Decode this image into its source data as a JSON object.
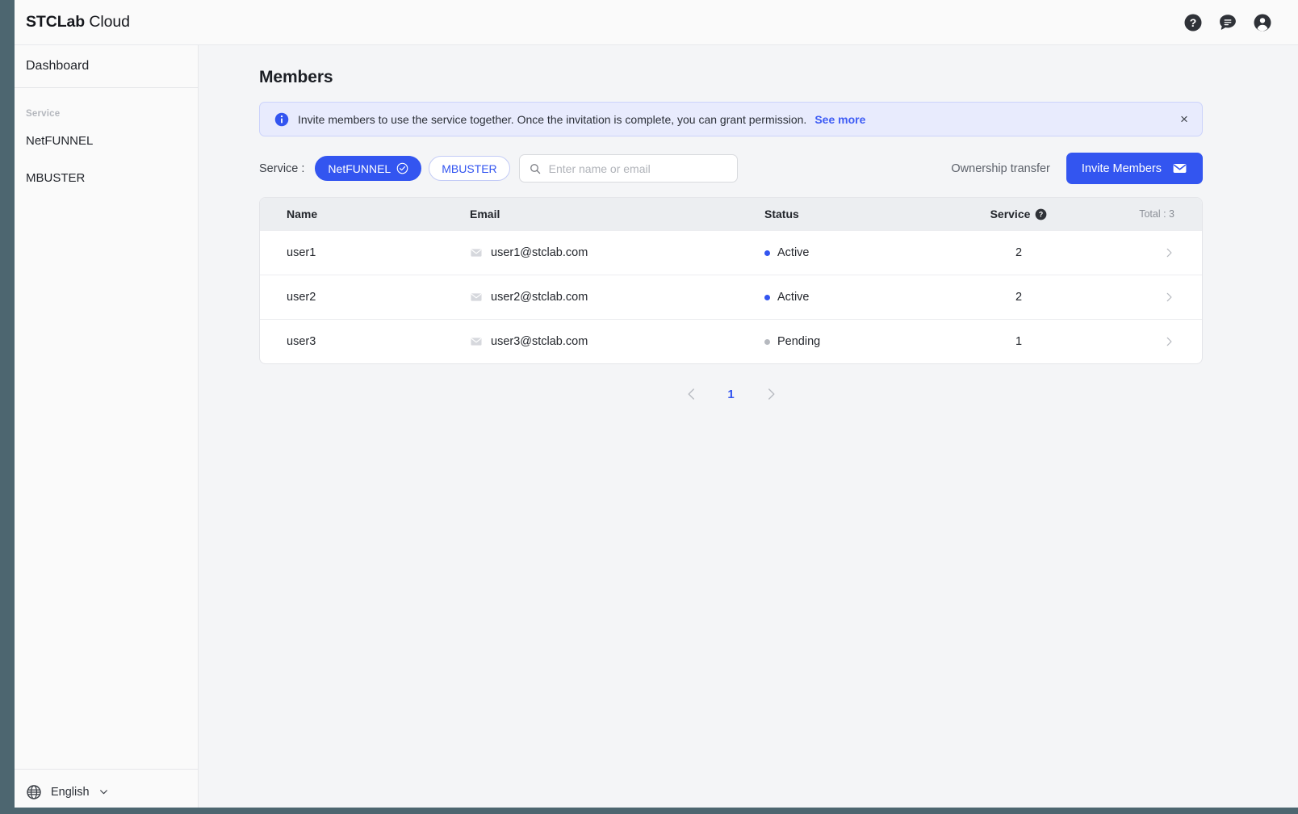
{
  "brand": {
    "bold": "STCLab",
    "regular": "Cloud"
  },
  "topbar": {
    "icons": [
      {
        "name": "help-icon",
        "label": "Help"
      },
      {
        "name": "chat-icon",
        "label": "Chat"
      },
      {
        "name": "account-icon",
        "label": "Account"
      }
    ]
  },
  "sidebar": {
    "dashboard_label": "Dashboard",
    "section_label": "Service",
    "items": [
      {
        "label": "NetFUNNEL"
      },
      {
        "label": "MBUSTER"
      }
    ],
    "language": {
      "label": "English"
    }
  },
  "main": {
    "page_title": "Members",
    "banner": {
      "text": "Invite members to use the service together. Once the invitation is complete, you can grant permission.",
      "link": "See more",
      "close": "×"
    },
    "filter": {
      "service_label": "Service :",
      "chips": [
        {
          "label": "NetFUNNEL",
          "active": true
        },
        {
          "label": "MBUSTER",
          "active": false
        }
      ],
      "search_placeholder": "Enter name or email",
      "search_value": "",
      "ownership_label": "Ownership transfer",
      "invite_label": "Invite Members"
    },
    "table": {
      "columns": [
        "Name",
        "Email",
        "Status",
        "Service"
      ],
      "total_label": "Total : 3",
      "rows": [
        {
          "name": "user1",
          "email": "user1@stclab.com",
          "status": "Active",
          "service": "2"
        },
        {
          "name": "user2",
          "email": "user2@stclab.com",
          "status": "Active",
          "service": "2"
        },
        {
          "name": "user3",
          "email": "user3@stclab.com",
          "status": "Pending",
          "service": "1"
        }
      ]
    },
    "pagination": {
      "prev": "‹",
      "current": "1",
      "next": "›"
    }
  },
  "colors": {
    "accent": "#3355f0",
    "banner_bg": "#e8ebfd",
    "status_active": "#3355f0",
    "status_pending": "#b6b9bf",
    "edge_strip": "#4d6670"
  }
}
